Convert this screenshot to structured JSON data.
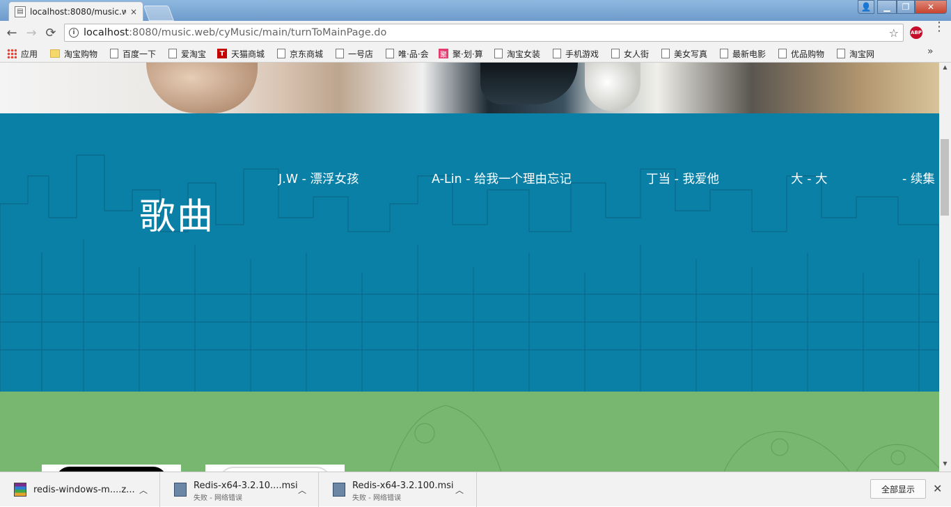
{
  "browser": {
    "tab_title": "localhost:8080/music.w",
    "tab_close": "×",
    "url_host": "localhost",
    "url_rest": ":8080/music.web/cyMusic/main/turnToMainPage.do",
    "star": "☆",
    "abp_label": "ABP",
    "window_controls": {
      "user": "👤",
      "minimize": "▁",
      "maximize": "❐",
      "close": "✕"
    },
    "nav": {
      "back": "←",
      "forward": "→",
      "reload": "⟳"
    },
    "menu": "⋮",
    "bookmarks_more": "»"
  },
  "bookmarks": [
    {
      "label": "应用",
      "icon": "apps-icon"
    },
    {
      "label": "淘宝购物",
      "icon": "folder-icon"
    },
    {
      "label": "百度一下",
      "icon": "page-icon"
    },
    {
      "label": "爱淘宝",
      "icon": "page-icon"
    },
    {
      "label": "天猫商城",
      "icon": "tmall-icon"
    },
    {
      "label": "京东商城",
      "icon": "page-icon"
    },
    {
      "label": "一号店",
      "icon": "page-icon"
    },
    {
      "label": "唯·品·会",
      "icon": "page-icon"
    },
    {
      "label": "聚·划·算",
      "icon": "ju-icon"
    },
    {
      "label": "淘宝女装",
      "icon": "page-icon"
    },
    {
      "label": "手机游戏",
      "icon": "page-icon"
    },
    {
      "label": "女人街",
      "icon": "page-icon"
    },
    {
      "label": "美女写真",
      "icon": "page-icon"
    },
    {
      "label": "最新电影",
      "icon": "page-icon"
    },
    {
      "label": "优品购物",
      "icon": "page-icon"
    },
    {
      "label": "淘宝网",
      "icon": "page-icon"
    }
  ],
  "bookmark_icon_glyphs": {
    "tmall": "T",
    "ju": "聚"
  },
  "page": {
    "songs_heading": "歌曲",
    "songs": [
      "J.W - 漂浮女孩",
      "A-Lin - 给我一个理由忘记",
      "丁当 - 我爱他",
      "大 - 大",
      "- 续集"
    ],
    "colors": {
      "songs_bg": "#0a80a7",
      "green_bg": "#78b76f"
    }
  },
  "downloads": [
    {
      "name": "redis-windows-m....z...",
      "status": "",
      "icon": "rar-archive-icon"
    },
    {
      "name": "Redis-x64-3.2.10....msi",
      "status": "失败 - 网络错误",
      "icon": "msi-installer-icon"
    },
    {
      "name": "Redis-x64-3.2.100.msi",
      "status": "失败 - 网络错误",
      "icon": "msi-installer-icon"
    }
  ],
  "download_caret": "︿",
  "show_all_label": "全部显示",
  "shelf_close": "✕",
  "scroll": {
    "up": "▲",
    "down": "▼"
  }
}
